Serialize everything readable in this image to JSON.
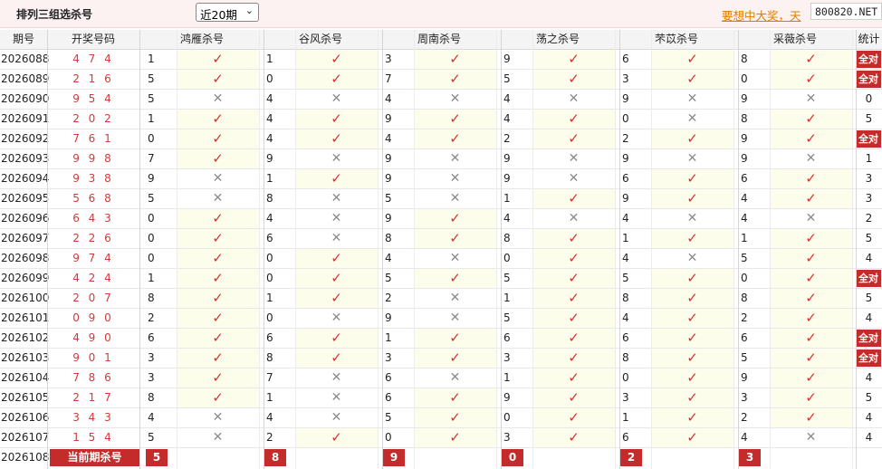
{
  "header": {
    "title": "排列三组选杀号",
    "period_select": "近20期",
    "promo_text": "要想中大奖，天",
    "site_badge": "800820.NET"
  },
  "columns": {
    "issue": "期号",
    "draw": "开奖号码",
    "experts": [
      "鸿雁杀号",
      "谷风杀号",
      "周南杀号",
      "荡之杀号",
      "芣苡杀号",
      "采薇杀号"
    ],
    "total": "统计"
  },
  "all_correct_label": "全对",
  "rows": [
    {
      "issue": "2026088",
      "draw": "4 7 4",
      "kills": [
        1,
        1,
        3,
        9,
        6,
        8
      ],
      "hits": [
        true,
        true,
        true,
        true,
        true,
        true
      ],
      "total": "全对"
    },
    {
      "issue": "2026089",
      "draw": "2 1 6",
      "kills": [
        5,
        0,
        7,
        5,
        3,
        0
      ],
      "hits": [
        true,
        true,
        true,
        true,
        true,
        true
      ],
      "total": "全对"
    },
    {
      "issue": "2026090",
      "draw": "9 5 4",
      "kills": [
        5,
        4,
        4,
        4,
        9,
        9
      ],
      "hits": [
        false,
        false,
        false,
        false,
        false,
        false
      ],
      "total": "0"
    },
    {
      "issue": "2026091",
      "draw": "2 0 2",
      "kills": [
        1,
        4,
        9,
        4,
        0,
        8
      ],
      "hits": [
        true,
        true,
        true,
        true,
        false,
        true
      ],
      "total": "5"
    },
    {
      "issue": "2026092",
      "draw": "7 6 1",
      "kills": [
        0,
        4,
        4,
        2,
        2,
        9
      ],
      "hits": [
        true,
        true,
        true,
        true,
        true,
        true
      ],
      "total": "全对"
    },
    {
      "issue": "2026093",
      "draw": "9 9 8",
      "kills": [
        7,
        9,
        9,
        9,
        9,
        9
      ],
      "hits": [
        true,
        false,
        false,
        false,
        false,
        false
      ],
      "total": "1"
    },
    {
      "issue": "2026094",
      "draw": "9 3 8",
      "kills": [
        9,
        1,
        9,
        9,
        6,
        6
      ],
      "hits": [
        false,
        true,
        false,
        false,
        true,
        true
      ],
      "total": "3"
    },
    {
      "issue": "2026095",
      "draw": "5 6 8",
      "kills": [
        5,
        8,
        5,
        1,
        9,
        4
      ],
      "hits": [
        false,
        false,
        false,
        true,
        true,
        true
      ],
      "total": "3"
    },
    {
      "issue": "2026096",
      "draw": "6 4 3",
      "kills": [
        0,
        4,
        9,
        4,
        4,
        4
      ],
      "hits": [
        true,
        false,
        true,
        false,
        false,
        false
      ],
      "total": "2"
    },
    {
      "issue": "2026097",
      "draw": "2 2 6",
      "kills": [
        0,
        6,
        8,
        8,
        1,
        1
      ],
      "hits": [
        true,
        false,
        true,
        true,
        true,
        true
      ],
      "total": "5"
    },
    {
      "issue": "2026098",
      "draw": "9 7 4",
      "kills": [
        0,
        0,
        4,
        0,
        4,
        5
      ],
      "hits": [
        true,
        true,
        false,
        true,
        false,
        true
      ],
      "total": "4"
    },
    {
      "issue": "2026099",
      "draw": "4 2 4",
      "kills": [
        1,
        0,
        5,
        5,
        5,
        0
      ],
      "hits": [
        true,
        true,
        true,
        true,
        true,
        true
      ],
      "total": "全对"
    },
    {
      "issue": "2026100",
      "draw": "2 0 7",
      "kills": [
        8,
        1,
        2,
        1,
        8,
        8
      ],
      "hits": [
        true,
        true,
        false,
        true,
        true,
        true
      ],
      "total": "5"
    },
    {
      "issue": "2026101",
      "draw": "0 9 0",
      "kills": [
        2,
        0,
        9,
        5,
        4,
        2
      ],
      "hits": [
        true,
        false,
        false,
        true,
        true,
        true
      ],
      "total": "4"
    },
    {
      "issue": "2026102",
      "draw": "4 9 0",
      "kills": [
        6,
        6,
        1,
        6,
        6,
        6
      ],
      "hits": [
        true,
        true,
        true,
        true,
        true,
        true
      ],
      "total": "全对"
    },
    {
      "issue": "2026103",
      "draw": "9 0 1",
      "kills": [
        3,
        8,
        3,
        3,
        8,
        5
      ],
      "hits": [
        true,
        true,
        true,
        true,
        true,
        true
      ],
      "total": "全对"
    },
    {
      "issue": "2026104",
      "draw": "7 8 6",
      "kills": [
        3,
        7,
        6,
        1,
        0,
        9
      ],
      "hits": [
        true,
        false,
        false,
        true,
        true,
        true
      ],
      "total": "4"
    },
    {
      "issue": "2026105",
      "draw": "2 1 7",
      "kills": [
        8,
        1,
        6,
        9,
        3,
        3
      ],
      "hits": [
        true,
        false,
        true,
        true,
        true,
        true
      ],
      "total": "5"
    },
    {
      "issue": "2026106",
      "draw": "3 4 3",
      "kills": [
        4,
        4,
        5,
        0,
        1,
        2
      ],
      "hits": [
        false,
        false,
        true,
        true,
        true,
        true
      ],
      "total": "4"
    },
    {
      "issue": "2026107",
      "draw": "1 5 4",
      "kills": [
        5,
        2,
        0,
        3,
        6,
        4
      ],
      "hits": [
        false,
        true,
        true,
        true,
        true,
        false
      ],
      "total": "4"
    }
  ],
  "current": {
    "issue": "2026108",
    "label": "当前期杀号",
    "kills": [
      5,
      8,
      9,
      0,
      2,
      3
    ]
  },
  "colors": {
    "accent_red": "#c42b2b",
    "tick_red": "#d63333",
    "promo_orange": "#e07b00",
    "hit_bg": "#fdfdec"
  }
}
